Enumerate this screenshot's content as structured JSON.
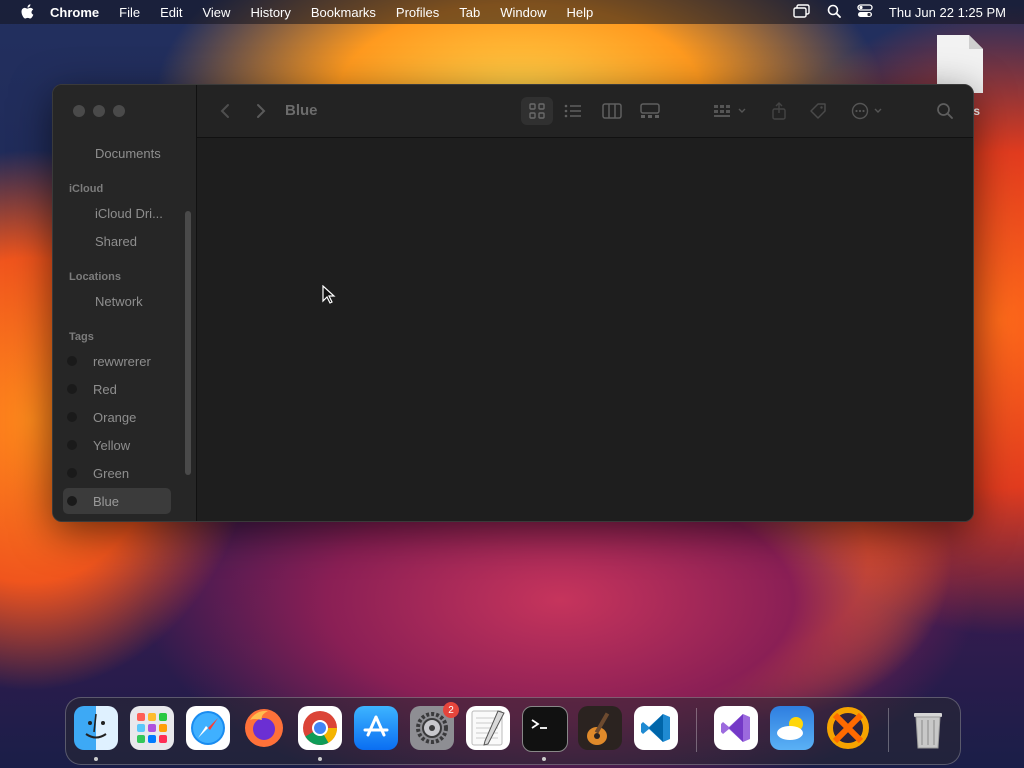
{
  "menubar": {
    "app": "Chrome",
    "items": [
      "File",
      "Edit",
      "View",
      "History",
      "Bookmarks",
      "Profiles",
      "Tab",
      "Window",
      "Help"
    ],
    "datetime": "Thu Jun 22  1:25 PM"
  },
  "desktop": {
    "file_label": "os"
  },
  "finder": {
    "path_title": "Blue",
    "sidebar": {
      "favorites": [
        {
          "label": "Documents"
        }
      ],
      "icloud_header": "iCloud",
      "icloud": [
        {
          "label": "iCloud Dri..."
        },
        {
          "label": "Shared"
        }
      ],
      "locations_header": "Locations",
      "locations": [
        {
          "label": "Network"
        }
      ],
      "tags_header": "Tags",
      "tags": [
        {
          "label": "rewwrerer"
        },
        {
          "label": "Red"
        },
        {
          "label": "Orange"
        },
        {
          "label": "Yellow"
        },
        {
          "label": "Green"
        },
        {
          "label": "Blue",
          "selected": true
        }
      ]
    }
  },
  "dock": {
    "apps": [
      "finder-icon",
      "launchpad-icon",
      "safari-icon",
      "firefox-icon",
      "chrome-icon",
      "app-store-icon",
      "system-settings-icon",
      "textedit-icon",
      "terminal-icon",
      "garageband-icon",
      "vscode-icon",
      "visual-studio-icon",
      "weather-icon",
      "crossover-icon",
      "trash-icon"
    ],
    "settings_badge": "2"
  },
  "colors": {
    "window_bg": "#1e1e1e",
    "sidebar_bg": "#262626",
    "selected": "#3b3b3b"
  }
}
